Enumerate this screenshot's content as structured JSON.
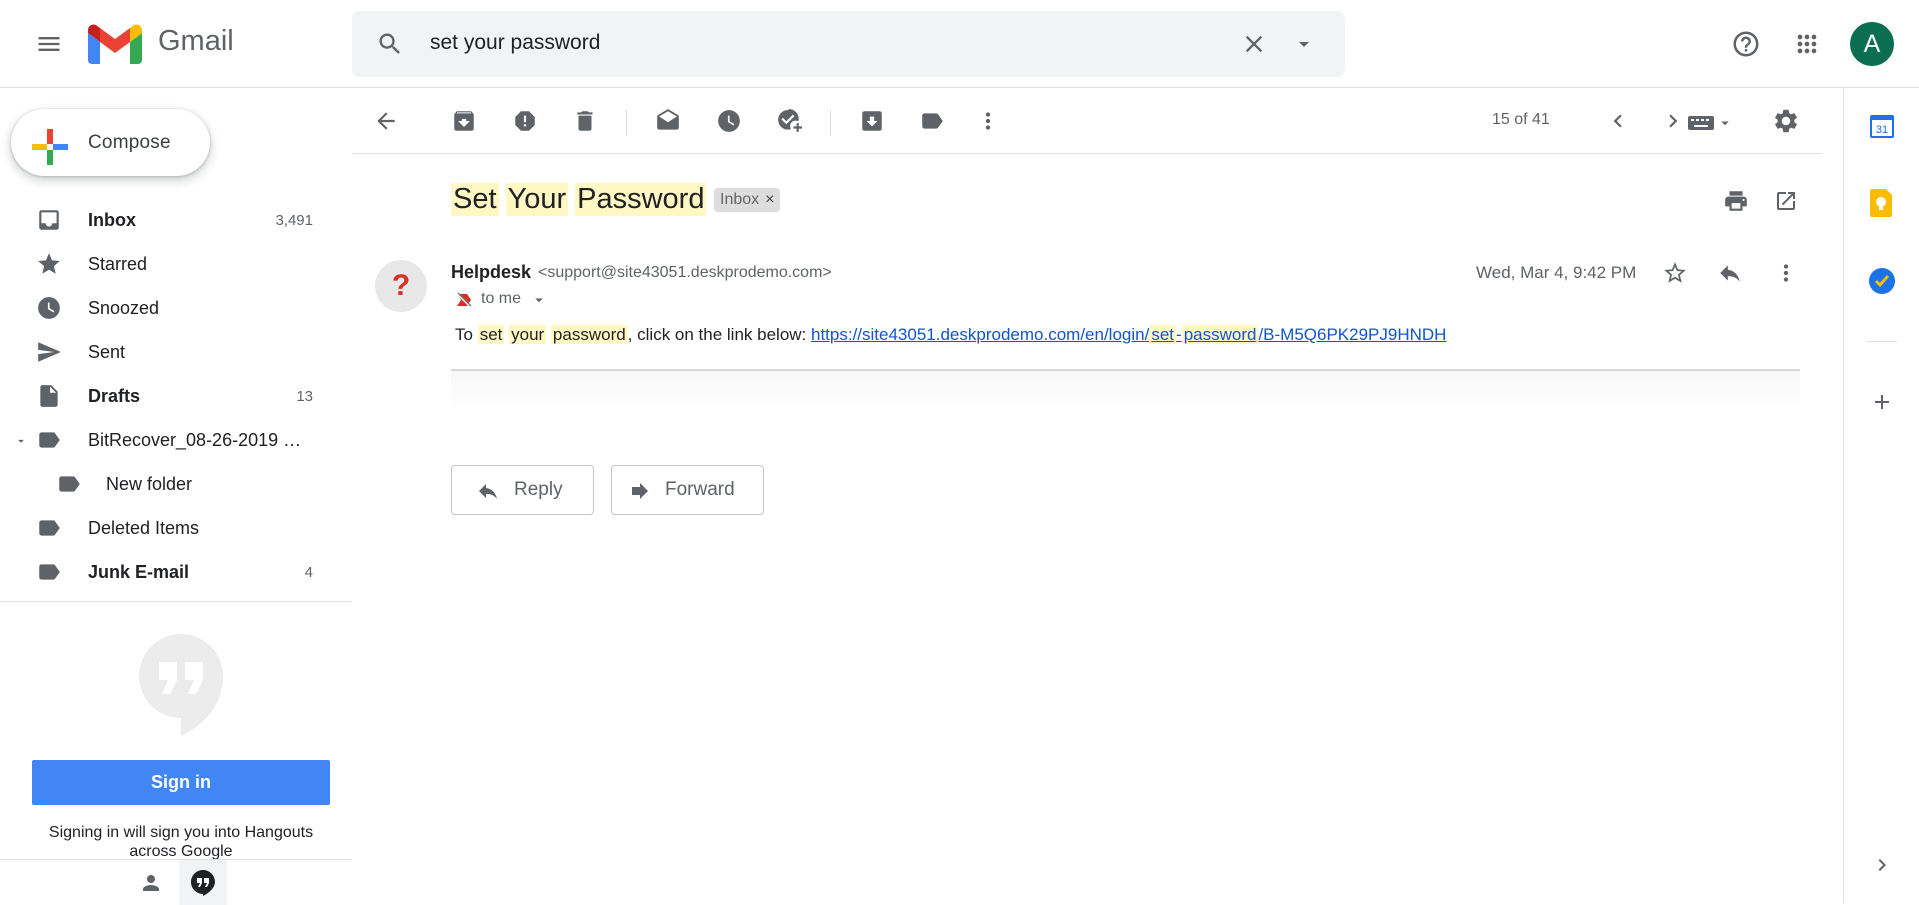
{
  "header": {
    "app_name": "Gmail",
    "search_query": "set your password",
    "avatar_letter": "A"
  },
  "sidebar": {
    "compose_label": "Compose",
    "items": [
      {
        "label": "Inbox",
        "count": "3,491"
      },
      {
        "label": "Starred",
        "count": ""
      },
      {
        "label": "Snoozed",
        "count": ""
      },
      {
        "label": "Sent",
        "count": ""
      },
      {
        "label": "Drafts",
        "count": "13"
      },
      {
        "label": "BitRecover_08-26-2019 …",
        "count": ""
      },
      {
        "label": "New folder",
        "count": ""
      },
      {
        "label": "Deleted Items",
        "count": ""
      },
      {
        "label": "Junk E-mail",
        "count": "4"
      }
    ]
  },
  "hangouts": {
    "signin_label": "Sign in",
    "note": "Signing in will sign you into Hangouts across Google"
  },
  "toolbar": {
    "page_count": "15 of 41"
  },
  "message": {
    "subject_words": [
      "Set",
      "Your",
      "Password"
    ],
    "label_chip": "Inbox",
    "label_chip_close": "×",
    "avatar_glyph": "?",
    "sender_name": "Helpdesk",
    "sender_email": "<support@site43051.deskprodemo.com>",
    "recipient": "to me",
    "date": "Wed, Mar 4, 9:42 PM",
    "body": {
      "t1": "To ",
      "h1": "set",
      "t2": " ",
      "h2": "your",
      "t3": " ",
      "h3": "password",
      "t4": ", click on the link below: ",
      "link_a": "https://site43051.deskprodemo.com/en/login/",
      "link_h1": "set",
      "link_b": "-",
      "link_h2": "password",
      "link_c": "/B-M5Q6PK29PJ9HNDH"
    }
  },
  "actions": {
    "reply_label": "Reply",
    "forward_label": "Forward"
  },
  "side_panel": {
    "calendar_day": "31"
  },
  "colors": {
    "highlight": "#fff8c4",
    "link": "#1155cc",
    "signin": "#4285f4",
    "avatar": "#0b6e50"
  }
}
